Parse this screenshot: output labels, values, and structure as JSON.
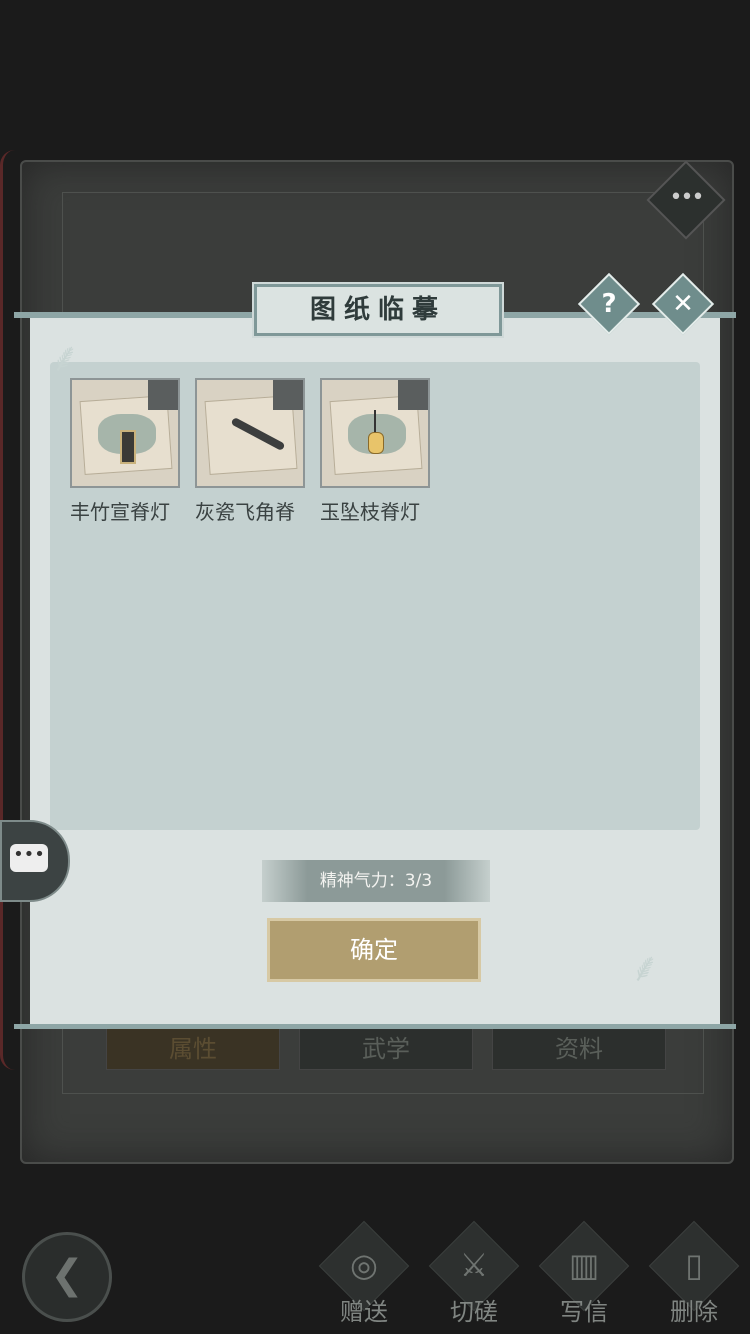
{
  "dialog": {
    "title": "图纸临摹",
    "help_label": "?",
    "close_label": "✕",
    "items": [
      {
        "name": "丰竹宣脊灯",
        "icon": "lantern-scroll-icon"
      },
      {
        "name": "灰瓷飞角脊",
        "icon": "roof-ridge-icon"
      },
      {
        "name": "玉坠枝脊灯",
        "icon": "hanging-lantern-icon"
      }
    ],
    "stamina_label": "精神气力：3/3",
    "confirm_label": "确定"
  },
  "book": {
    "more_label": "•••",
    "tabs": [
      "属性",
      "武学",
      "资料"
    ]
  },
  "bottom_bar": {
    "back_label": "❮",
    "actions": [
      {
        "label": "赠送",
        "icon": "scroll-icon"
      },
      {
        "label": "切磋",
        "icon": "sword-icon"
      },
      {
        "label": "写信",
        "icon": "letter-icon"
      },
      {
        "label": "删除",
        "icon": "trash-icon"
      }
    ]
  },
  "chat": {
    "label": "•••"
  }
}
